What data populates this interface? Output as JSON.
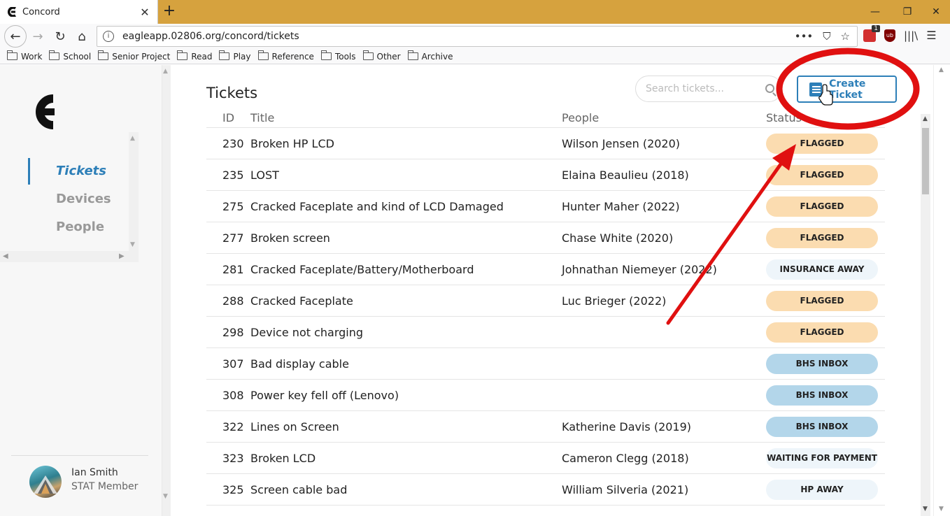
{
  "browser": {
    "tab_title": "Concord",
    "url": "eagleapp.02806.org/concord/tickets",
    "ext_badge": "1",
    "bookmarks": [
      "Work",
      "School",
      "Senior Project",
      "Read",
      "Play",
      "Reference",
      "Tools",
      "Other",
      "Archive"
    ]
  },
  "sidebar": {
    "nav": [
      "Tickets",
      "Devices",
      "People"
    ],
    "active": "Tickets",
    "user_name": "Ian Smith",
    "user_role": "STAT Member"
  },
  "main": {
    "title": "Tickets",
    "search_placeholder": "Search tickets...",
    "create_label": "Create Ticket",
    "columns": [
      "ID",
      "Title",
      "People",
      "Status"
    ],
    "rows": [
      {
        "id": "230",
        "title": "Broken HP LCD",
        "people": "Wilson Jensen (2020)",
        "status": "FLAGGED"
      },
      {
        "id": "235",
        "title": "LOST",
        "people": "Elaina Beaulieu (2018)",
        "status": "FLAGGED"
      },
      {
        "id": "275",
        "title": "Cracked Faceplate and kind of LCD Damaged",
        "people": "Hunter Maher (2022)",
        "status": "FLAGGED"
      },
      {
        "id": "277",
        "title": "Broken screen",
        "people": "Chase White (2020)",
        "status": "FLAGGED"
      },
      {
        "id": "281",
        "title": "Cracked Faceplate/Battery/Motherboard",
        "people": "Johnathan Niemeyer (2022)",
        "status": "INSURANCE AWAY"
      },
      {
        "id": "288",
        "title": "Cracked Faceplate",
        "people": "Luc Brieger (2022)",
        "status": "FLAGGED"
      },
      {
        "id": "298",
        "title": "Device not charging",
        "people": "",
        "status": "FLAGGED"
      },
      {
        "id": "307",
        "title": "Bad display cable",
        "people": "",
        "status": "BHS INBOX"
      },
      {
        "id": "308",
        "title": "Power key fell off (Lenovo)",
        "people": "",
        "status": "BHS INBOX"
      },
      {
        "id": "322",
        "title": "Lines on Screen",
        "people": "Katherine Davis (2019)",
        "status": "BHS INBOX"
      },
      {
        "id": "323",
        "title": "Broken LCD",
        "people": "Cameron Clegg (2018)",
        "status": "WAITING FOR PAYMENT"
      },
      {
        "id": "325",
        "title": "Screen cable bad",
        "people": "William Silveria (2021)",
        "status": "HP AWAY"
      }
    ]
  },
  "status_colors": {
    "FLAGGED": "#fbdcb0",
    "INSURANCE AWAY": "#eef5fa",
    "BHS INBOX": "#b3d6ea",
    "WAITING FOR PAYMENT": "#eef5fa",
    "HP AWAY": "#eef5fa"
  },
  "colors": {
    "accent": "#2d7fb8",
    "tab_strip": "#d6a23e",
    "annotation": "#e01010"
  }
}
